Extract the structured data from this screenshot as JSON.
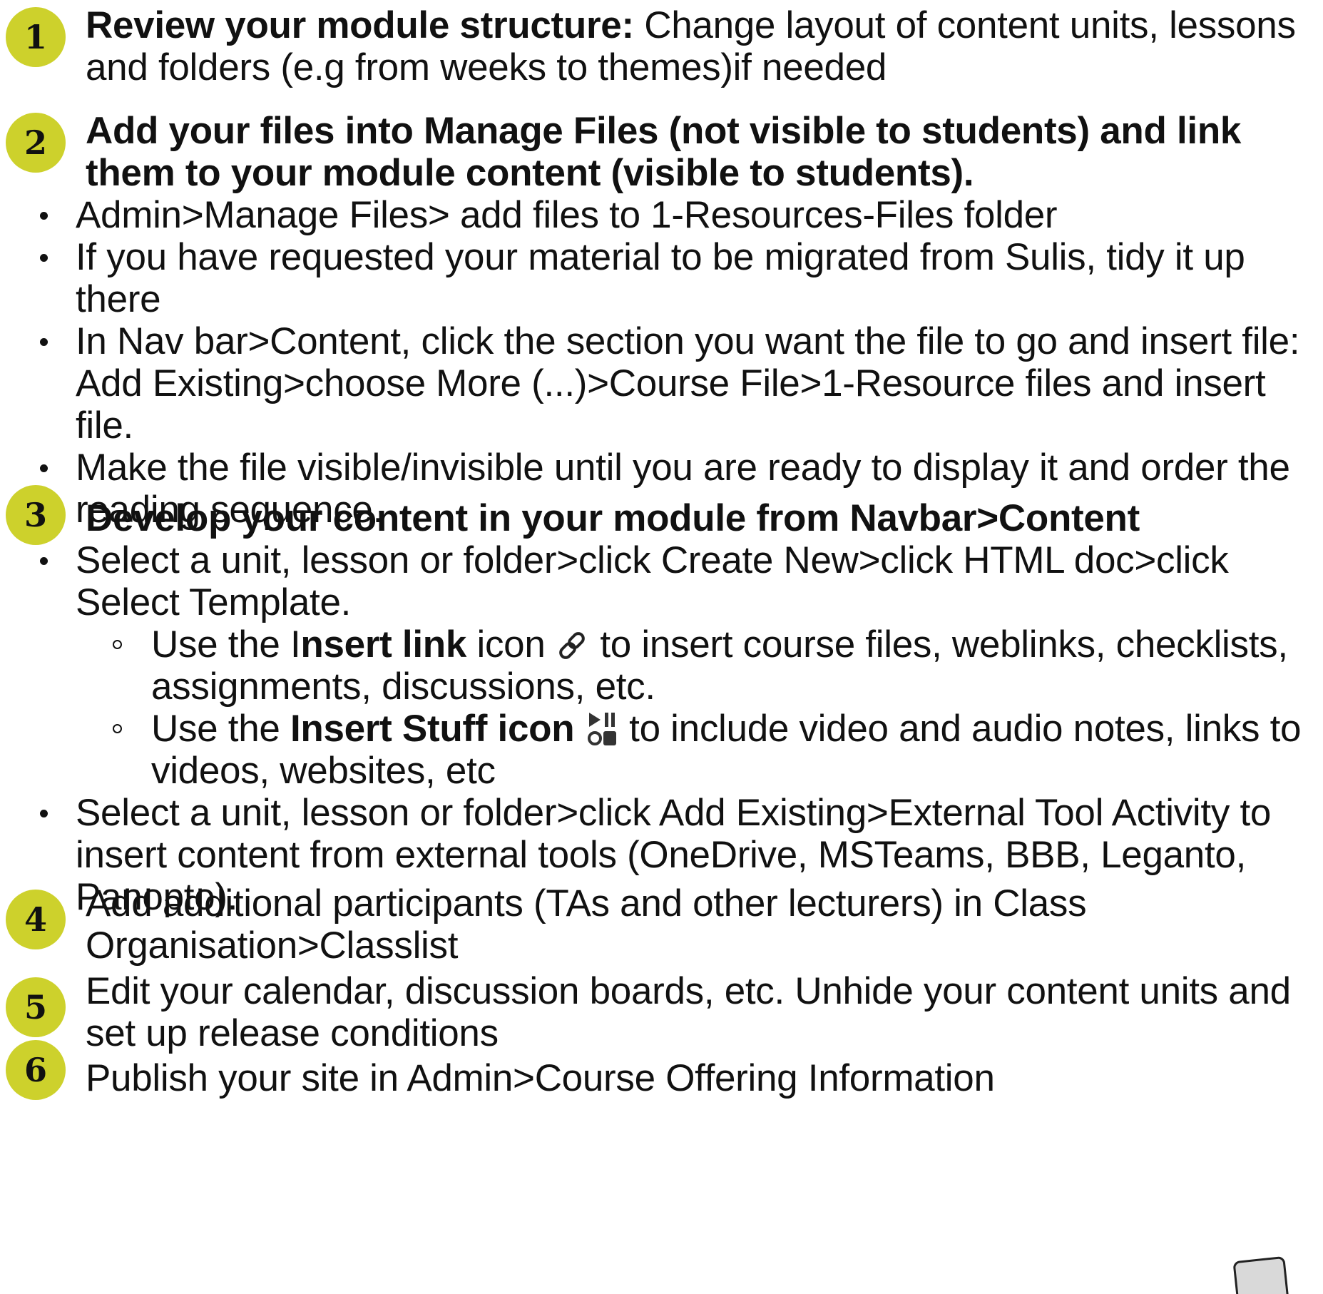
{
  "accent_color": "#cdd12c",
  "steps": [
    {
      "number": "1",
      "title": "Review your module structure:",
      "text": " Change layout of content units, lessons and folders (e.g from weeks to themes)if needed"
    },
    {
      "number": "2",
      "title": "Add your files into Manage Files (not visible to students) and link them to your module content (visible to students).",
      "bullets": [
        "Admin>Manage Files> add files to 1-Resources-Files folder",
        "If you have requested your material to be migrated from Sulis, tidy it up there",
        "In Nav bar>Content, click the section you want the file to go and insert file: Add Existing>choose More (...)>Course File>1-Resource files and insert file.",
        "Make the file visible/invisible until you are ready to display it and order the reading sequence."
      ]
    },
    {
      "number": "3",
      "title": "Develop your content in your module from Navbar>Content",
      "bullet1": "Select a unit, lesson or folder>click Create New>click HTML doc>click Select Template.",
      "sub1": {
        "pre": "Use the I",
        "bold": "nsert link",
        "mid": " icon ",
        "post": " to insert course files, weblinks, checklists, assignments, discussions, etc."
      },
      "sub2": {
        "pre": "Use the ",
        "bold": "Insert Stuff icon",
        "mid": " ",
        "post": " to include video and audio notes, links to videos, websites, etc"
      },
      "bullet2": "Select a unit, lesson or folder>click Add Existing>External Tool Activity to insert content from external tools (OneDrive, MSTeams, BBB, Leganto, Panopto)."
    },
    {
      "number": "4",
      "title": "Add additional participants (TAs and other lecturers) in Class Organisation>Classlist"
    },
    {
      "number": "5",
      "title": "Edit your calendar, discussion boards, etc. Unhide your content units and set up release conditions"
    },
    {
      "number": "6",
      "title": "Publish your site in Admin>Course Offering Information"
    }
  ]
}
